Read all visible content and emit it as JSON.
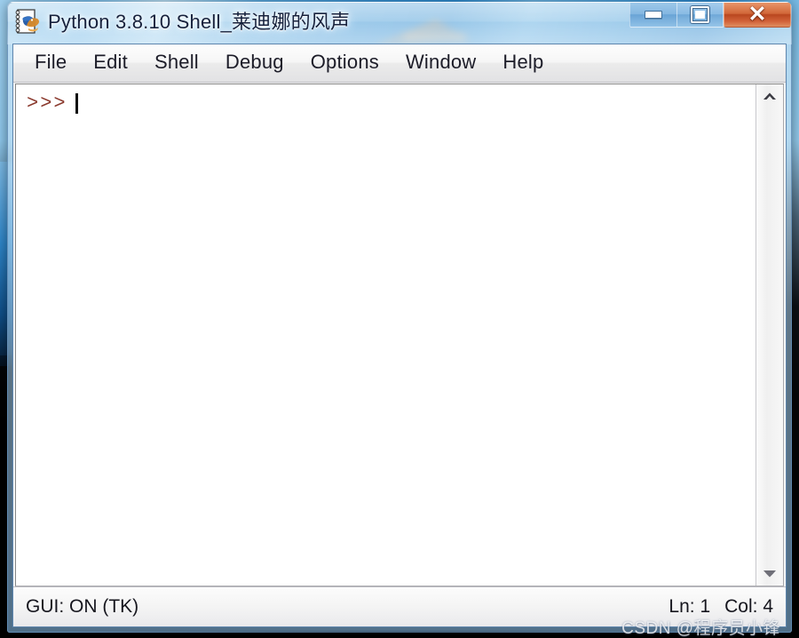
{
  "window": {
    "title": "Python 3.8.10 Shell_莱迪娜的风声",
    "app_icon": "python-idle-icon",
    "controls": {
      "minimize_label": "–",
      "maximize_label": "□",
      "close_label": "✕"
    }
  },
  "menubar": {
    "items": [
      {
        "label": "File"
      },
      {
        "label": "Edit"
      },
      {
        "label": "Shell"
      },
      {
        "label": "Debug"
      },
      {
        "label": "Options"
      },
      {
        "label": "Window"
      },
      {
        "label": "Help"
      }
    ]
  },
  "editor": {
    "prompt": ">>>",
    "content": "",
    "prompt_color": "#8b3a2e",
    "background": "#ffffff"
  },
  "scrollbar": {
    "up_icon": "chevron-up-icon",
    "down_icon": "chevron-down-icon"
  },
  "statusbar": {
    "left": "GUI: ON (TK)",
    "line": "Ln: 1",
    "column": "Col: 4"
  },
  "watermark": {
    "text": "CSDN @程序员小锋"
  },
  "colors": {
    "frame_blue": "#5d85ad",
    "close_red": "#b9471f",
    "prompt_maroon": "#8b3a2e",
    "menu_text": "#1c1c28"
  }
}
